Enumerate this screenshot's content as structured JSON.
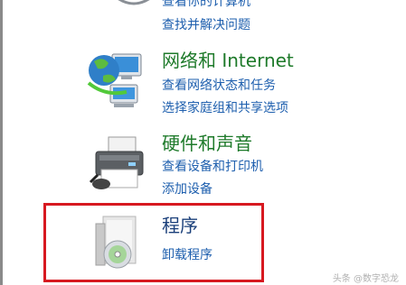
{
  "system": {
    "top_cut_link": "查看你的计算机",
    "find_fix": "查找并解决问题"
  },
  "network": {
    "title": "网络和 Internet",
    "links": [
      "查看网络状态和任务",
      "选择家庭组和共享选项"
    ]
  },
  "hardware": {
    "title": "硬件和声音",
    "links": [
      "查看设备和打印机",
      "添加设备"
    ]
  },
  "programs": {
    "title": "程序",
    "links": [
      "卸载程序"
    ]
  },
  "icons": {
    "system": "shield-icon",
    "network": "network-globe-icon",
    "hardware": "printer-icon",
    "programs": "software-box-cd-icon"
  },
  "colors": {
    "link": "#1e5fae",
    "category_title": "#1e7a2a",
    "highlight": "#d71920"
  },
  "watermark": "头条 @数字恐龙"
}
